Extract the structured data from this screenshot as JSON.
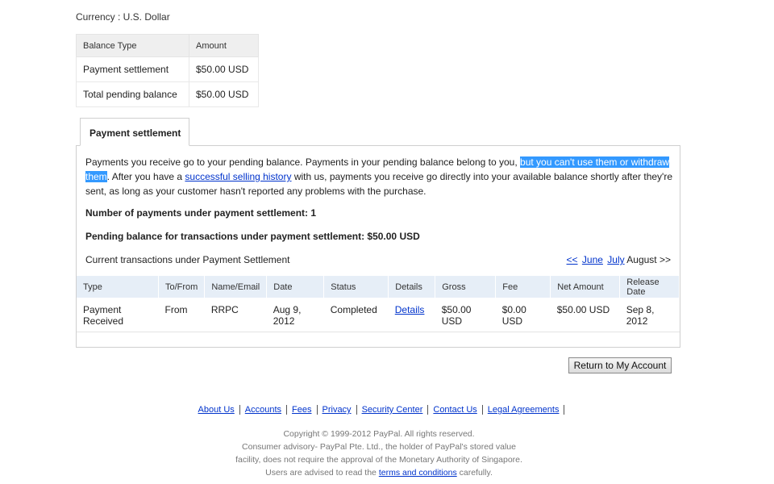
{
  "currency_label": "Currency : U.S. Dollar",
  "balance_table": {
    "headers": [
      "Balance Type",
      "Amount"
    ],
    "rows": [
      {
        "type": "Payment settlement",
        "amount": "$50.00 USD"
      },
      {
        "type": "Total pending balance",
        "amount": "$50.00 USD"
      }
    ]
  },
  "tab": {
    "label": "Payment settlement"
  },
  "description": {
    "part1": "Payments you receive go to your pending balance. Payments in your pending balance belong to you, ",
    "highlight": "but you can't use them or withdraw them",
    "part2": ". After you have a ",
    "link": "successful selling history",
    "part3": " with us, payments you receive go directly into your available balance shortly after they're sent, as long as your customer hasn't reported any problems with the purchase."
  },
  "summary": {
    "count_line": "Number of payments under payment settlement: 1",
    "pending_line": "Pending balance for transactions under payment settlement: $50.00 USD"
  },
  "current_label": "Current transactions under Payment Settlement",
  "months": {
    "prev": "<<",
    "june": "June",
    "july": "July",
    "current": "August >>"
  },
  "tx_table": {
    "headers": [
      "Type",
      "To/From",
      "Name/Email",
      "Date",
      "Status",
      "Details",
      "Gross",
      "Fee",
      "Net Amount",
      "Release Date"
    ],
    "rows": [
      {
        "type": "Payment Received",
        "tofrom": "From",
        "name": "RRPC",
        "date": "Aug 9, 2012",
        "status": "Completed",
        "details": "Details",
        "gross": "$50.00 USD",
        "fee": "$0.00 USD",
        "net": "$50.00 USD",
        "release": "Sep 8, 2012"
      }
    ]
  },
  "return_button": "Return to My Account",
  "footer": {
    "links": [
      "About Us",
      "Accounts",
      "Fees",
      "Privacy",
      "Security Center",
      "Contact Us",
      "Legal Agreements"
    ],
    "copyright": "Copyright © 1999-2012 PayPal. All rights reserved.",
    "advisory1": "Consumer advisory- PayPal Pte. Ltd., the holder of PayPal's stored value",
    "advisory2": "facility, does not require the approval of the Monetary Authority of Singapore.",
    "advisory3_pre": "Users are advised to read the ",
    "advisory3_link": "terms and conditions",
    "advisory3_post": " carefully."
  },
  "colors": {
    "highlight": "#3399ff",
    "link": "#0033cc",
    "header_bg": "#e6eef7"
  }
}
